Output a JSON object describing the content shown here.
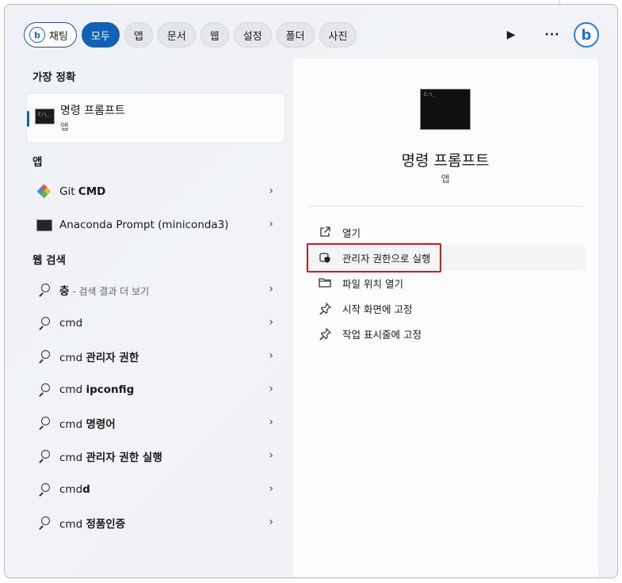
{
  "topbar": {
    "chips": [
      {
        "label": "채팅",
        "kind": "chat"
      },
      {
        "label": "모두",
        "kind": "active"
      },
      {
        "label": "앱",
        "kind": "normal"
      },
      {
        "label": "문서",
        "kind": "normal"
      },
      {
        "label": "웹",
        "kind": "normal"
      },
      {
        "label": "설정",
        "kind": "normal"
      },
      {
        "label": "폴더",
        "kind": "normal"
      },
      {
        "label": "사진",
        "kind": "normal"
      }
    ],
    "play_icon": "▶",
    "more_icon": "···",
    "bing_logo": "b"
  },
  "best_match": {
    "heading": "가장 정확",
    "name": "명령 프롬프트",
    "type": "앱"
  },
  "apps": {
    "heading": "앱",
    "items": [
      {
        "prefix": "Git ",
        "bold": "CMD",
        "icon": "git-icon"
      },
      {
        "prefix": "Anaconda Prompt (miniconda3)",
        "bold": "",
        "icon": "terminal-icon"
      }
    ]
  },
  "web": {
    "heading": "웹 검색",
    "items": [
      {
        "prefix": "",
        "bold": "층",
        "hint": " - 검색 결과 더 보기"
      },
      {
        "prefix": "cmd",
        "bold": "",
        "hint": ""
      },
      {
        "prefix": "cmd ",
        "bold": "관리자 권한",
        "hint": ""
      },
      {
        "prefix": "cmd ",
        "bold": "ipconfig",
        "hint": ""
      },
      {
        "prefix": "cmd ",
        "bold": "명령어",
        "hint": ""
      },
      {
        "prefix": "cmd ",
        "bold": "관리자 권한 실행",
        "hint": ""
      },
      {
        "prefix": "cmd",
        "bold": "d",
        "hint": ""
      },
      {
        "prefix": "cmd ",
        "bold": "정품인증",
        "hint": ""
      }
    ]
  },
  "detail": {
    "title": "명령 프롬프트",
    "subtitle": "앱",
    "actions": [
      {
        "label": "열기",
        "icon": "open-external-icon"
      },
      {
        "label": "관리자 권한으로 실행",
        "icon": "shield-icon"
      },
      {
        "label": "파일 위치 열기",
        "icon": "folder-icon"
      },
      {
        "label": "시작 화면에 고정",
        "icon": "pin-icon"
      },
      {
        "label": "작업 표시줄에 고정",
        "icon": "pin-icon"
      }
    ]
  },
  "colors": {
    "accent": "#0f62b8",
    "highlight_box": "#e0161e"
  }
}
